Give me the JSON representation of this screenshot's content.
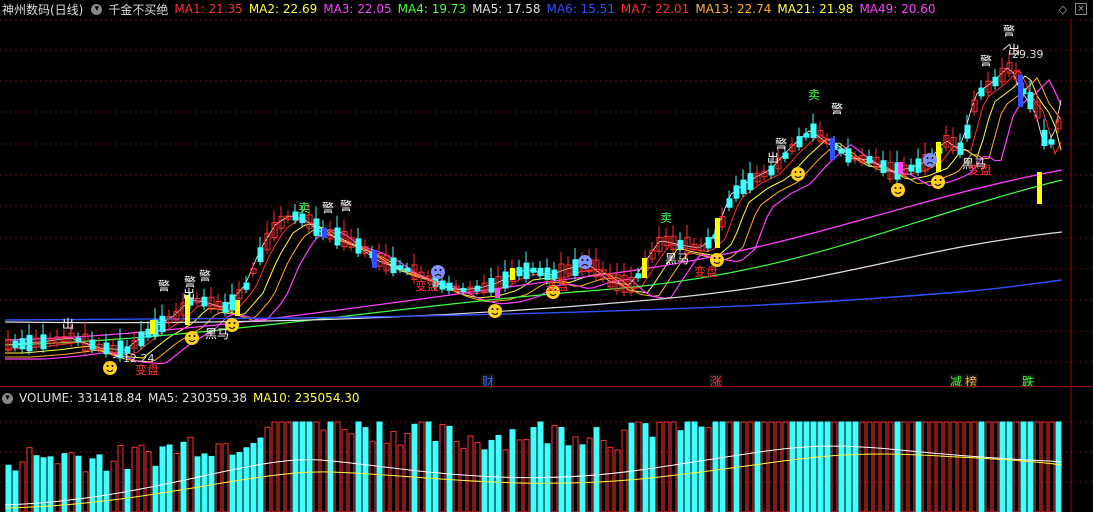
{
  "header": {
    "title": "神州数码(日线)",
    "indicator_name": "千金不买绝",
    "ma": [
      {
        "label": "MA1: 21.35",
        "color": "#ff3030"
      },
      {
        "label": "MA2: 22.69",
        "color": "#ffff40"
      },
      {
        "label": "MA3: 22.05",
        "color": "#ff40ff"
      },
      {
        "label": "MA4: 19.73",
        "color": "#40ff40"
      },
      {
        "label": "MA5: 17.58",
        "color": "#e0e0e0"
      },
      {
        "label": "MA6: 15.51",
        "color": "#3050ff"
      },
      {
        "label": "MA7: 22.01",
        "color": "#ff3030"
      },
      {
        "label": "MA13: 22.74",
        "color": "#ffb030"
      },
      {
        "label": "MA21: 21.98",
        "color": "#ffff40"
      },
      {
        "label": "MA49: 20.60",
        "color": "#ff40ff"
      }
    ]
  },
  "volume_header": {
    "label": "VOLUME: 331418.84",
    "ma5": "MA5: 230359.38",
    "ma10": "MA10: 235054.30"
  },
  "annotations": {
    "high_price": "29.39",
    "low_price": "12.24"
  },
  "markers": {
    "warn": "警",
    "sell": "卖",
    "out": "出",
    "black_horse": "黑马",
    "change": "变盘"
  },
  "events": [
    "财",
    "涨",
    "减",
    "榜",
    "跌"
  ],
  "colors": {
    "up": "#ff3030",
    "down": "#40ffff",
    "grid": "#6a1010",
    "yellow_bar": "#ffff00"
  }
}
